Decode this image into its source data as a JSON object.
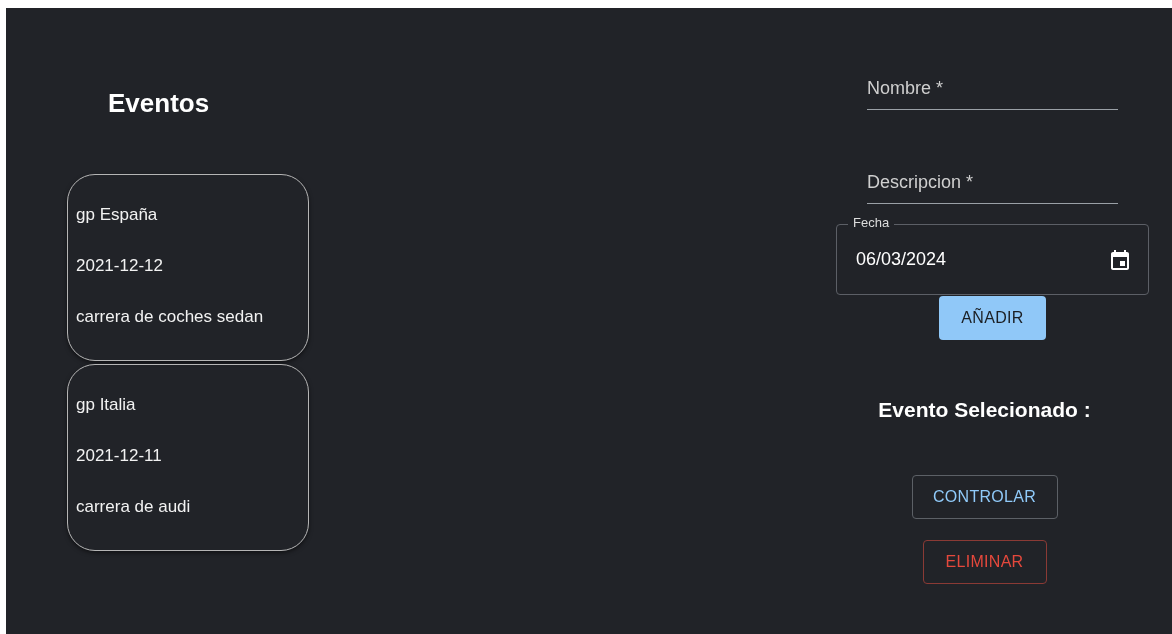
{
  "events_title": "Eventos",
  "events": [
    {
      "name": "gp España",
      "date": "2021-12-12",
      "description": "carrera de coches sedan"
    },
    {
      "name": "gp Italia",
      "date": "2021-12-11",
      "description": "carrera de audi"
    }
  ],
  "form": {
    "fields": [
      {
        "kind": "underline",
        "placeholder": "Nombre *"
      },
      {
        "kind": "underline",
        "placeholder": "Descripcion *"
      },
      {
        "kind": "date",
        "label": "Fecha",
        "value": "06/03/2024"
      }
    ],
    "submit": {
      "label": "AÑADIR",
      "kind": "contained"
    }
  },
  "selected_title": "Evento Selecionado :",
  "actions": [
    {
      "label": "CONTROLAR",
      "kind": "outlined"
    },
    {
      "label": "ELIMINAR",
      "kind": "danger"
    }
  ]
}
